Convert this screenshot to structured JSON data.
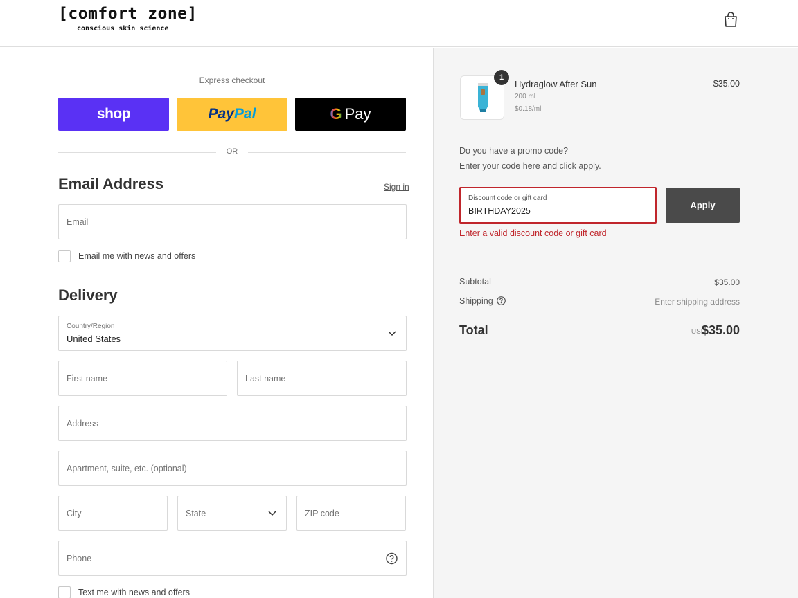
{
  "brand": {
    "name": "[comfort zone]",
    "tagline": "conscious skin science"
  },
  "header": {
    "cart_icon": "shopping-bag-icon"
  },
  "express": {
    "label": "Express checkout",
    "shop_label": "shop",
    "paypal_label_1": "Pay",
    "paypal_label_2": "Pal",
    "gpay_g": "G",
    "gpay_label": "Pay",
    "or_label": "OR"
  },
  "email_section": {
    "title": "Email Address",
    "sign_in": "Sign in",
    "email_placeholder": "Email",
    "newsletter_label": "Email me with news and offers"
  },
  "delivery": {
    "title": "Delivery",
    "country_label": "Country/Region",
    "country_value": "United States",
    "first_name_placeholder": "First name",
    "last_name_placeholder": "Last name",
    "address_placeholder": "Address",
    "apartment_placeholder": "Apartment, suite, etc. (optional)",
    "city_placeholder": "City",
    "state_placeholder": "State",
    "zip_placeholder": "ZIP code",
    "phone_placeholder": "Phone",
    "sms_label": "Text me with news and offers"
  },
  "order": {
    "item": {
      "name": "Hydraglow After Sun",
      "quantity": "1",
      "size": "200 ml",
      "unit_price": "$0.18/ml",
      "price": "$35.00"
    },
    "promo_question": "Do you have a promo code?",
    "promo_instruction": "Enter your code here and click apply.",
    "discount_label": "Discount code or gift card",
    "discount_value": "BIRTHDAY2025",
    "apply_label": "Apply",
    "error_message": "Enter a valid discount code or gift card",
    "subtotal_label": "Subtotal",
    "subtotal_value": "$35.00",
    "shipping_label": "Shipping",
    "shipping_value": "Enter shipping address",
    "total_label": "Total",
    "currency": "USD",
    "total_value": "$35.00"
  },
  "colors": {
    "shop_purple": "#5a31f4",
    "paypal_yellow": "#ffc439",
    "error_red": "#c0262c",
    "apply_gray": "#4a4a4a"
  }
}
